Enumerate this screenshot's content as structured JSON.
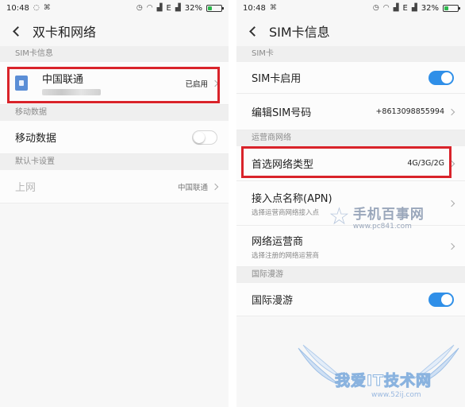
{
  "status_bar": {
    "time": "10:48",
    "network": "E",
    "battery": "32%",
    "battery_level": 0.32
  },
  "left_screen": {
    "title": "双卡和网络",
    "sim_section": {
      "header": "SIM卡信息",
      "carrier": "中国联通",
      "status": "已启用"
    },
    "mobile_data_section": {
      "header": "移动数据",
      "label": "移动数据",
      "toggle_on": false
    },
    "default_card_section": {
      "header": "默认卡设置",
      "label": "上网",
      "value": "中国联通"
    }
  },
  "right_screen": {
    "title": "SIM卡信息",
    "sim_section": {
      "header": "SIM卡",
      "enable_label": "SIM卡启用",
      "enable_on": true,
      "edit_number_label": "编辑SIM号码",
      "edit_number_value": "+8613098855994"
    },
    "carrier_section": {
      "header": "运营商网络",
      "preferred_network_label": "首选网络类型",
      "preferred_network_value": "4G/3G/2G",
      "apn_label": "接入点名称(APN)",
      "apn_sub": "选择运营商网络接入点",
      "operator_label": "网络运营商",
      "operator_sub": "选择注册的网络运营商"
    },
    "roaming_section": {
      "header": "国际漫游",
      "roaming_label": "国际漫游",
      "roaming_on": true
    }
  },
  "watermarks": {
    "pc841_title": "手机百事网",
    "pc841_url": "www.pc841.com",
    "woaiit_title": "我爱IT技术网",
    "woaiit_url": "www.52ij.com"
  },
  "colors": {
    "highlight": "#d9232a",
    "toggle_on": "#2f8fe8",
    "sim_icon": "#5b8ed6",
    "battery": "#2db84d"
  }
}
